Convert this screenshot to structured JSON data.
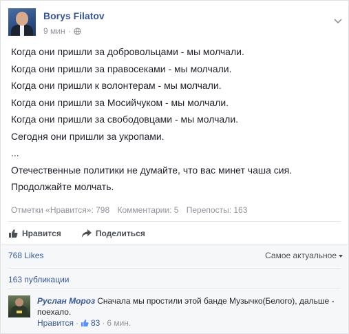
{
  "post": {
    "author": "Borys Filatov",
    "time": "9 мин",
    "privacy_sep": "·",
    "lines": [
      "Когда они пришли за добровольцами - мы молчали.",
      "Когда они пришли за правосеками - мы молчали.",
      "Когда они пришли к волонтерам - мы молчали.",
      "Когда они пришли за Мосийчуком - мы молчали.",
      "Когда они пришли за свободовцами - мы молчали.",
      "Сегодня они пришли за укропами.",
      "...",
      "Отечественные политики не думайте, что вас минет чаша сия.",
      "Продолжайте молчать."
    ],
    "stats": {
      "likes": "Отметки «Нравится»: 798",
      "comments": "Комментарии: 5",
      "shares": "Перепосты: 163"
    },
    "actions": {
      "like": "Нравится",
      "share": "Поделиться"
    }
  },
  "feedback": {
    "likes_count": "768 Likes",
    "sort_label": "Самое актуальное",
    "publications": "163 публикации"
  },
  "comment": {
    "author": "Руслан Мороз",
    "text": "Сначала мы простили этой банде Музычко(Белого), дальше - поехало.",
    "like_label": "Нравится",
    "sep": "·",
    "like_count": "83",
    "time": "6 мин."
  },
  "colors": {
    "link": "#365899",
    "muted": "#90949c",
    "text": "#1d2129"
  }
}
